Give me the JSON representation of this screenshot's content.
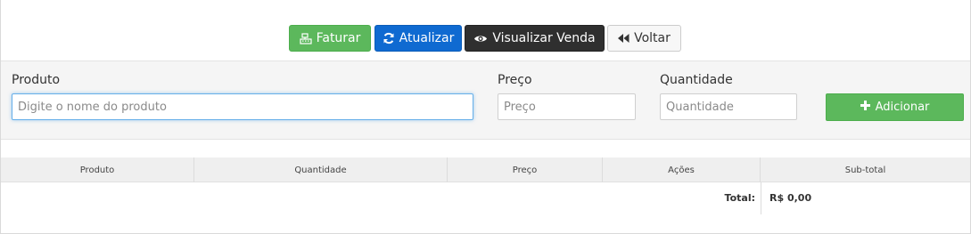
{
  "toolbar": {
    "faturar_label": "Faturar",
    "atualizar_label": "Atualizar",
    "visualizar_label": "Visualizar Venda",
    "voltar_label": "Voltar"
  },
  "form": {
    "produto_label": "Produto",
    "produto_placeholder": "Digite o nome do produto",
    "preco_label": "Preço",
    "preco_placeholder": "Preço",
    "quantidade_label": "Quantidade",
    "quantidade_placeholder": "Quantidade",
    "adicionar_label": "Adicionar"
  },
  "table": {
    "columns": [
      "Produto",
      "Quantidade",
      "Preço",
      "Ações",
      "Sub-total"
    ],
    "total_label": "Total:",
    "total_value": "R$ 0,00"
  },
  "colors": {
    "success": "#5cb85c",
    "primary": "#0f6ad1",
    "dark": "#2f2f2f",
    "default": "#f7f7f7"
  },
  "icons": {
    "faturar": "cash-register-icon",
    "atualizar": "refresh-icon",
    "visualizar": "eye-icon",
    "voltar": "backward-icon",
    "adicionar": "plus-icon"
  }
}
